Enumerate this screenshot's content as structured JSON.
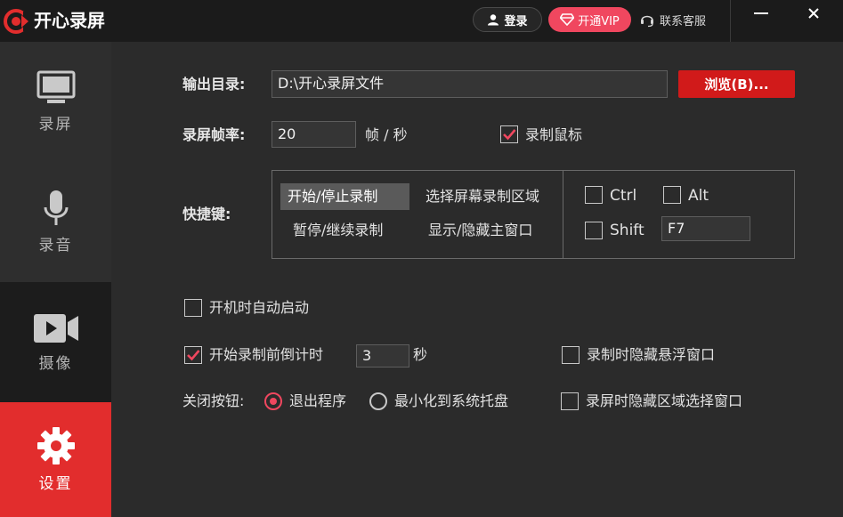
{
  "app": {
    "title": "开心录屏"
  },
  "header": {
    "login_label": "登录",
    "vip_label": "开通VIP",
    "service_label": "联系客服"
  },
  "sidebar": {
    "items": [
      {
        "label": "录屏",
        "icon": "monitor-icon"
      },
      {
        "label": "录音",
        "icon": "microphone-icon"
      },
      {
        "label": "摄像",
        "icon": "video-camera-icon"
      },
      {
        "label": "设置",
        "icon": "gear-icon",
        "active": true
      }
    ]
  },
  "settings": {
    "output_dir_label": "输出目录:",
    "output_dir_value": "D:\\开心录屏文件",
    "browse_label": "浏览(B)...",
    "fps_label": "录屏帧率:",
    "fps_value": "20",
    "fps_unit": "帧 / 秒",
    "record_mouse_label": "录制鼠标",
    "record_mouse_checked": true,
    "hotkey_label": "快捷键:",
    "hotkey_actions": [
      {
        "label": "开始/停止录制",
        "selected": true
      },
      {
        "label": "选择屏幕录制区域",
        "selected": false
      },
      {
        "label": "暂停/继续录制",
        "selected": false
      },
      {
        "label": "显示/隐藏主窗口",
        "selected": false
      }
    ],
    "modifiers": {
      "ctrl_label": "Ctrl",
      "ctrl_checked": false,
      "alt_label": "Alt",
      "alt_checked": false,
      "shift_label": "Shift",
      "shift_checked": false,
      "key_value": "F7"
    },
    "autostart_label": "开机时自动启动",
    "autostart_checked": false,
    "countdown_label": "开始录制前倒计时",
    "countdown_checked": true,
    "countdown_value": "3",
    "countdown_unit": "秒",
    "hide_float_label": "录制时隐藏悬浮窗口",
    "hide_float_checked": false,
    "close_button_label": "关闭按钮:",
    "close_exit_label": "退出程序",
    "close_minimize_label": "最小化到系统托盘",
    "close_selected": "exit",
    "hide_region_label": "录屏时隐藏区域选择窗口",
    "hide_region_checked": false
  },
  "colors": {
    "accent": "#e22d2d",
    "vip": "#f0475f",
    "browse": "#d11a1a"
  }
}
